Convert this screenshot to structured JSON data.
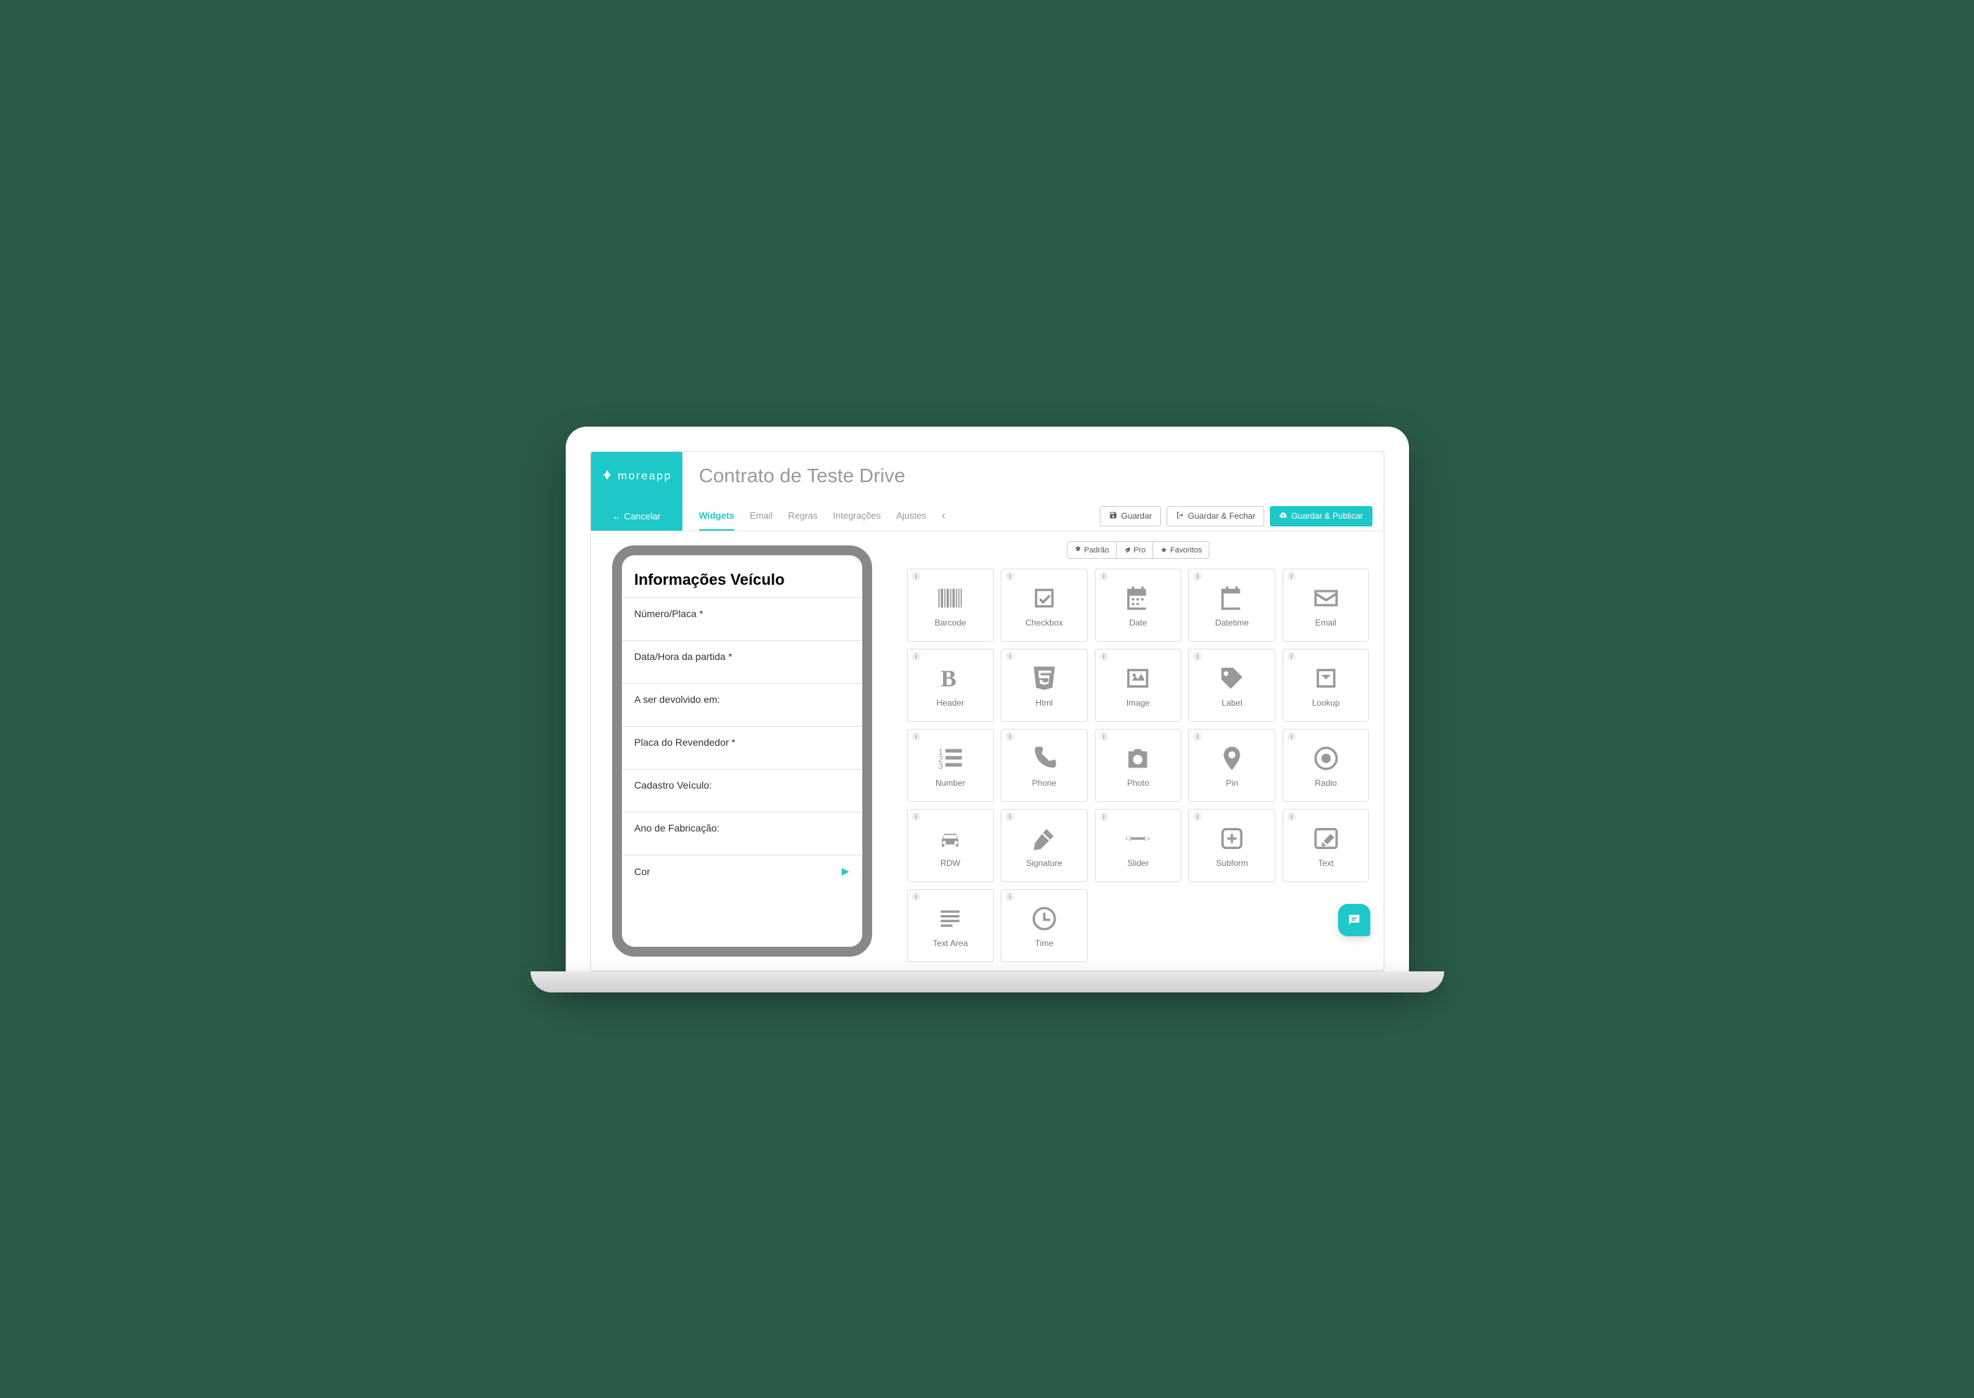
{
  "brand": "moreapp",
  "page_title": "Contrato de Teste Drive",
  "cancel_label": "Cancelar",
  "tabs": [
    "Widgets",
    "Email",
    "Regras",
    "Integrações",
    "Ajustes"
  ],
  "active_tab": 0,
  "actions": {
    "save": "Guardar",
    "save_close": "Guardar & Fechar",
    "save_publish": "Guardar & Publicar"
  },
  "filters": {
    "default": "Padrão",
    "pro": "Pro",
    "favorites": "Favoritos"
  },
  "form": {
    "title": "Informações Veículo",
    "fields": [
      "Número/Placa *",
      "Data/Hora da partida *",
      "A ser devolvido em:",
      "Placa do Revendedor *",
      "Cadastro Veículo:",
      "Ano de Fabricação:",
      "Cor"
    ]
  },
  "widgets": [
    {
      "id": "barcode",
      "label": "Barcode"
    },
    {
      "id": "checkbox",
      "label": "Checkbox"
    },
    {
      "id": "date",
      "label": "Date"
    },
    {
      "id": "datetime",
      "label": "Datetime"
    },
    {
      "id": "email",
      "label": "Email"
    },
    {
      "id": "header",
      "label": "Header"
    },
    {
      "id": "html",
      "label": "Html"
    },
    {
      "id": "image",
      "label": "Image"
    },
    {
      "id": "label",
      "label": "Label"
    },
    {
      "id": "lookup",
      "label": "Lookup"
    },
    {
      "id": "number",
      "label": "Number"
    },
    {
      "id": "phone",
      "label": "Phone"
    },
    {
      "id": "photo",
      "label": "Photo"
    },
    {
      "id": "pin",
      "label": "Pin"
    },
    {
      "id": "radio",
      "label": "Radio"
    },
    {
      "id": "rdw",
      "label": "RDW"
    },
    {
      "id": "signature",
      "label": "Signature"
    },
    {
      "id": "slider",
      "label": "Slider"
    },
    {
      "id": "subform",
      "label": "Subform"
    },
    {
      "id": "text",
      "label": "Text"
    },
    {
      "id": "textarea",
      "label": "Text Area"
    },
    {
      "id": "time",
      "label": "Time"
    }
  ]
}
